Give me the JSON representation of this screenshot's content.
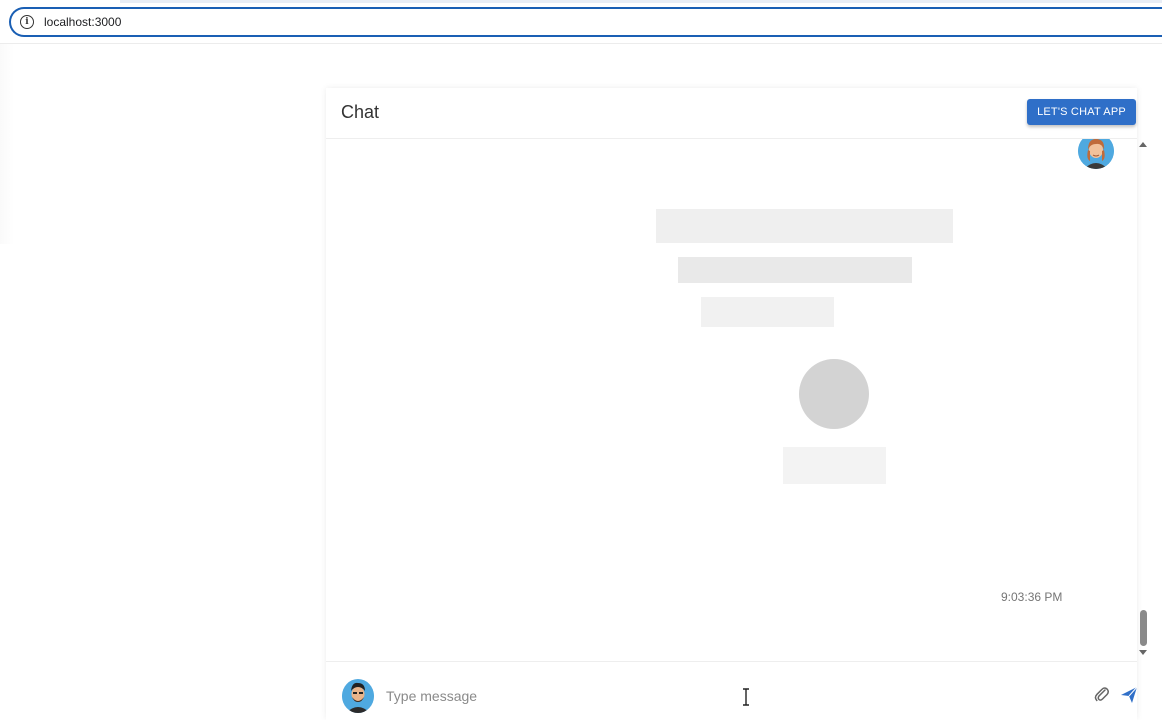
{
  "browser": {
    "url": "localhost:3000"
  },
  "chat": {
    "title": "Chat",
    "app_button_label": "LET'S CHAT APP",
    "message_time": "9:03:36 PM",
    "input_placeholder": "Type message"
  },
  "colors": {
    "accent": "#2f6fc8",
    "address_border": "#1a5fb4",
    "avatar_bg": "#4fa9e0",
    "skeleton": "#efefef"
  },
  "icons": [
    "info-icon",
    "attach-icon",
    "send-icon",
    "scroll-up-arrow",
    "scroll-down-arrow"
  ]
}
